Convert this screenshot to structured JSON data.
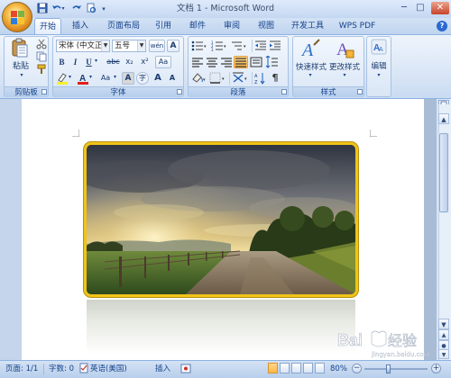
{
  "window": {
    "title": "文档 1 - Microsoft Word",
    "minimize": "─",
    "maximize": "□",
    "close": "✕"
  },
  "quick_access": {
    "save_icon": "save-icon",
    "undo_icon": "undo-icon",
    "redo_icon": "redo-icon"
  },
  "tabs": [
    {
      "label": "开始",
      "active": true
    },
    {
      "label": "插入",
      "active": false
    },
    {
      "label": "页面布局",
      "active": false
    },
    {
      "label": "引用",
      "active": false
    },
    {
      "label": "邮件",
      "active": false
    },
    {
      "label": "审阅",
      "active": false
    },
    {
      "label": "视图",
      "active": false
    },
    {
      "label": "开发工具",
      "active": false
    },
    {
      "label": "WPS PDF",
      "active": false
    }
  ],
  "help": "?",
  "ribbon": {
    "clipboard": {
      "label": "剪贴板",
      "paste": "粘贴"
    },
    "font": {
      "label": "字体",
      "font_name": "宋体 (中文正)",
      "font_size": "五号",
      "wen_btn": "wén",
      "a_box": "A",
      "bold": "B",
      "italic": "I",
      "underline": "U",
      "strike": "abc",
      "subscript": "x₂",
      "superscript": "x²",
      "clear_format": "Aa",
      "change_case": "Aa",
      "char_border": "A",
      "enclose": "字",
      "grow": "A",
      "shrink": "A"
    },
    "paragraph": {
      "label": "段落"
    },
    "styles": {
      "label": "样式",
      "quick_styles": "快速样式",
      "change_styles": "更改样式"
    },
    "editing": {
      "label": "编辑"
    }
  },
  "status": {
    "page": "页面: 1/1",
    "words": "字数: 0",
    "language": "英语(美国)",
    "insert": "插入",
    "zoom": "80%"
  },
  "watermark": "Baidu 经验",
  "watermark_url": "jingyan.baidu.com",
  "colors": {
    "accent": "#15428b",
    "ribbon_bg": "#dae6f6",
    "frame": "#f0c419"
  }
}
